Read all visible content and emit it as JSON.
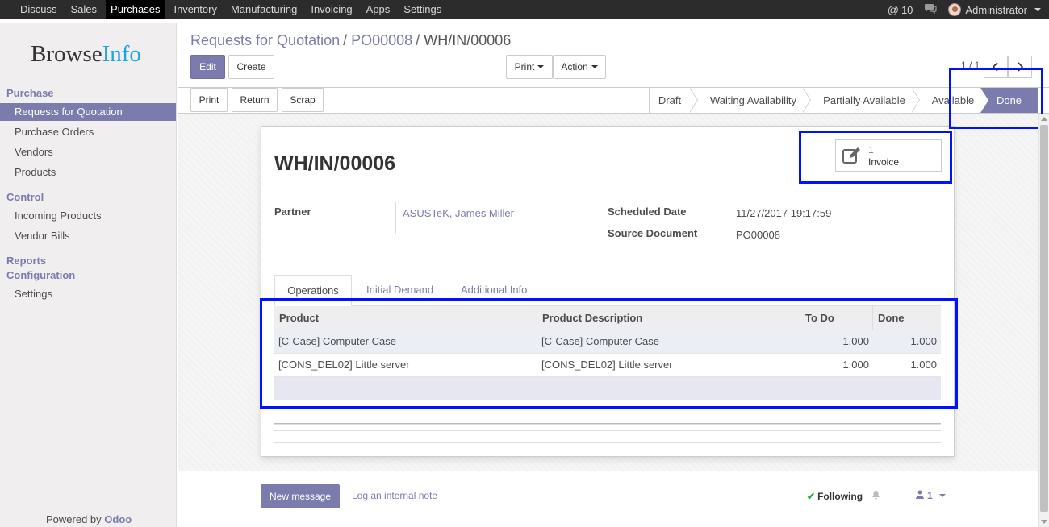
{
  "topbar": {
    "menu": [
      "Discuss",
      "Sales",
      "Purchases",
      "Inventory",
      "Manufacturing",
      "Invoicing",
      "Apps",
      "Settings"
    ],
    "active_menu": "Purchases",
    "messages_count": "10",
    "user_name": "Administrator"
  },
  "sidebar": {
    "logo_part1": "Browse",
    "logo_part2": "Info",
    "sections": {
      "purchase": "Purchase",
      "control": "Control",
      "reports": "Reports",
      "configuration": "Configuration"
    },
    "items": {
      "rfq": "Requests for Quotation",
      "purchase_orders": "Purchase Orders",
      "vendors": "Vendors",
      "products": "Products",
      "incoming_products": "Incoming Products",
      "vendor_bills": "Vendor Bills",
      "settings": "Settings"
    },
    "powered_by": "Powered by",
    "odoo": "Odoo"
  },
  "breadcrumb": {
    "level1": "Requests for Quotation",
    "level2": "PO00008",
    "current": "WH/IN/00006",
    "separator": "/"
  },
  "toolbar": {
    "edit": "Edit",
    "create": "Create",
    "print": "Print",
    "action": "Action",
    "pager": "1 / 1"
  },
  "header_buttons": {
    "print": "Print",
    "return": "Return",
    "scrap": "Scrap"
  },
  "statusbar": {
    "draft": "Draft",
    "waiting": "Waiting Availability",
    "partial": "Partially Available",
    "available": "Available",
    "done": "Done"
  },
  "form": {
    "title": "WH/IN/00006",
    "smart_button": {
      "count": "1",
      "label": "Invoice"
    },
    "partner_label": "Partner",
    "partner_value": "ASUSTeK, James Miller",
    "scheduled_label": "Scheduled Date",
    "scheduled_value": "11/27/2017 19:17:59",
    "source_label": "Source Document",
    "source_value": "PO00008"
  },
  "tabs": {
    "operations": "Operations",
    "initial_demand": "Initial Demand",
    "additional_info": "Additional Info"
  },
  "table": {
    "headers": {
      "product": "Product",
      "description": "Product Description",
      "todo": "To Do",
      "done": "Done"
    },
    "rows": [
      {
        "product": "[C-Case] Computer Case",
        "description": "[C-Case] Computer Case",
        "todo": "1.000",
        "done": "1.000"
      },
      {
        "product": "[CONS_DEL02] Little server",
        "description": "[CONS_DEL02] Little server",
        "todo": "1.000",
        "done": "1.000"
      }
    ]
  },
  "chatter": {
    "new_message": "New message",
    "log_note": "Log an internal note",
    "following": "Following",
    "followers_count": "1"
  },
  "colors": {
    "brand": "#7c7bad",
    "highlight": "#0012ff",
    "topbar": "#2c2c2c"
  }
}
